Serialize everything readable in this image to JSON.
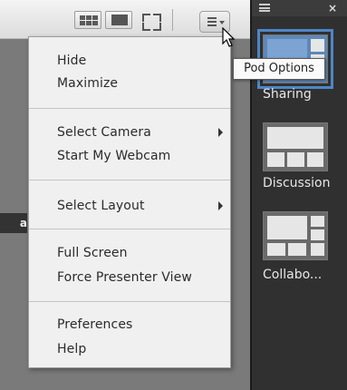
{
  "header": {
    "pod_options_tooltip": "Pod Options"
  },
  "partial_label": "a",
  "menu": {
    "items": [
      {
        "label": "Hide"
      },
      {
        "label": "Maximize"
      },
      {
        "label": "Select Camera"
      },
      {
        "label": "Start My Webcam"
      },
      {
        "label": "Select Layout"
      },
      {
        "label": "Full Screen"
      },
      {
        "label": "Force Presenter View"
      },
      {
        "label": "Preferences"
      },
      {
        "label": "Help"
      }
    ]
  },
  "layouts_panel": {
    "items": [
      {
        "label": "Sharing",
        "selected": true
      },
      {
        "label": "Discussion",
        "selected": false
      },
      {
        "label": "Collabo...",
        "selected": false
      }
    ]
  },
  "colors": {
    "accent": "#4f86c6",
    "panel_bg": "#303030",
    "menu_bg": "#f0f0f0"
  }
}
